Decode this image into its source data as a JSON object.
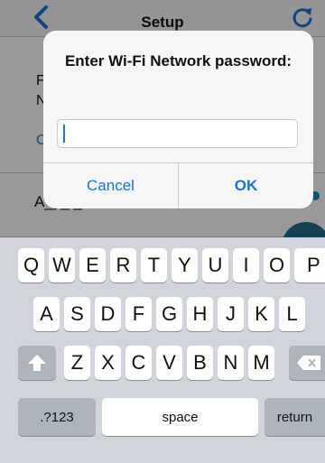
{
  "navbar": {
    "title": "Setup",
    "back_icon": "chevron-left-icon",
    "refresh_icon": "refresh-icon"
  },
  "background": {
    "peek_1": "F",
    "peek_2": "N",
    "peek_3": "C",
    "row_label": "A_y_ _"
  },
  "alert": {
    "title": "Enter Wi-Fi Network password:",
    "input_value": "",
    "input_placeholder": "",
    "cancel_label": "Cancel",
    "ok_label": "OK"
  },
  "keyboard": {
    "row1": [
      "Q",
      "W",
      "E",
      "R",
      "T",
      "Y",
      "U",
      "I",
      "O",
      "P"
    ],
    "row2": [
      "A",
      "S",
      "D",
      "F",
      "G",
      "H",
      "J",
      "K",
      "L"
    ],
    "row3": [
      "Z",
      "X",
      "C",
      "V",
      "B",
      "N",
      "M"
    ],
    "numbers_label": ".?123",
    "space_label": "space",
    "return_label": "return",
    "shift_icon": "shift-icon",
    "delete_icon": "delete-icon"
  },
  "colors": {
    "accent": "#1a73d8",
    "keyboard_bg": "#d1d5db",
    "key_bg": "#ffffff",
    "special_key_bg": "#aeb4bc"
  }
}
